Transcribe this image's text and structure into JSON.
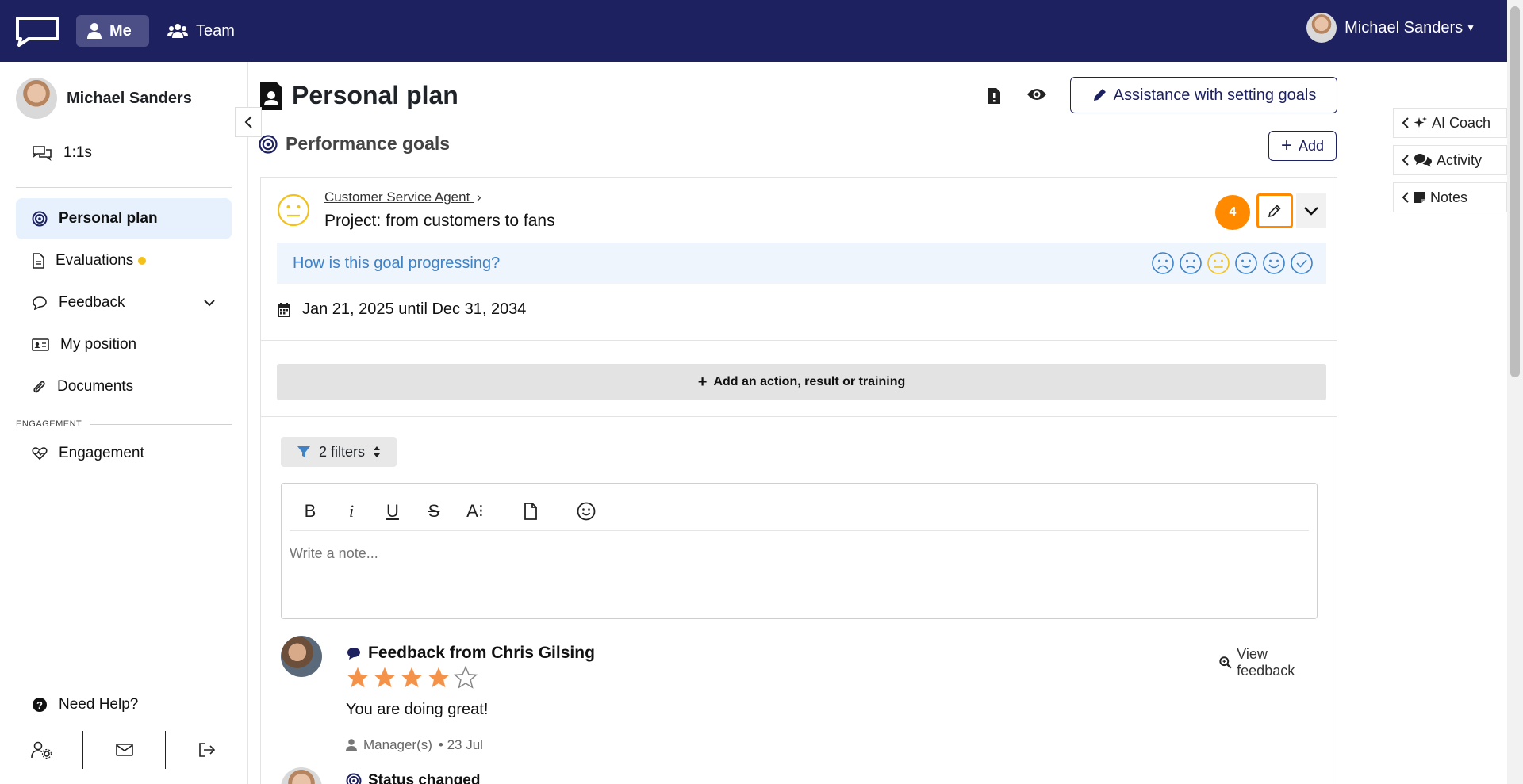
{
  "topbar": {
    "nav": [
      {
        "label": "Me"
      },
      {
        "label": "Team"
      }
    ],
    "user_name": "Michael Sanders"
  },
  "sidebar": {
    "user_name": "Michael Sanders",
    "items": [
      {
        "label": "1:1s"
      },
      {
        "label": "Personal plan"
      },
      {
        "label": "Evaluations"
      },
      {
        "label": "Feedback"
      },
      {
        "label": "My position"
      },
      {
        "label": "Documents"
      }
    ],
    "engagement_heading": "ENGAGEMENT",
    "engagement_item": "Engagement",
    "help": "Need Help?"
  },
  "main": {
    "title": "Personal plan",
    "assist_button": "Assistance with setting goals",
    "section_title": "Performance goals",
    "add_button": "Add",
    "goal": {
      "parent": "Customer Service Agent",
      "title": "Project: from customers to fans",
      "step_badge": "4",
      "progress_question": "How is this goal progressing?",
      "date_range": "Jan 21, 2025 until Dec 31, 2034",
      "add_action": "Add an action, result or training",
      "filters": "2 filters",
      "note_placeholder": "Write a note..."
    },
    "feedback": {
      "title": "Feedback from Chris Gilsing",
      "rating": 4,
      "rating_max": 5,
      "message": "You are doing great!",
      "meta_role": "Manager(s)",
      "meta_date": "• 23 Jul",
      "view_link": "View feedback"
    },
    "next_item": "Status changed"
  },
  "right_panel": {
    "items": [
      {
        "label": "AI Coach"
      },
      {
        "label": "Activity"
      },
      {
        "label": "Notes"
      }
    ]
  },
  "colors": {
    "topbar": "#1e2160",
    "accent_orange": "#ff8a00",
    "star": "#f5924a",
    "progress_blue": "#3f82c6"
  }
}
